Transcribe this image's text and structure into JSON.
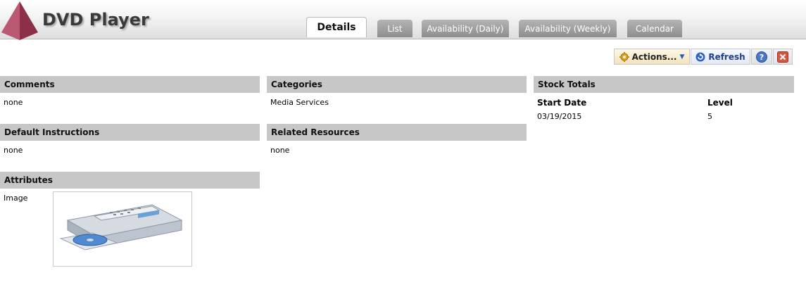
{
  "header": {
    "title": "DVD Player",
    "tabs": [
      {
        "label": "Details",
        "active": true
      },
      {
        "label": "List",
        "active": false
      },
      {
        "label": "Availability (Daily)",
        "active": false
      },
      {
        "label": "Availability (Weekly)",
        "active": false
      },
      {
        "label": "Calendar",
        "active": false
      }
    ]
  },
  "toolbar": {
    "actions_label": "Actions...",
    "refresh_label": "Refresh",
    "help_icon": "help-icon",
    "close_icon": "close-icon"
  },
  "panels": {
    "comments": {
      "title": "Comments",
      "value": "none"
    },
    "default_instructions": {
      "title": "Default Instructions",
      "value": "none"
    },
    "attributes": {
      "title": "Attributes",
      "label": "Image"
    },
    "categories": {
      "title": "Categories",
      "value": "Media Services"
    },
    "related_resources": {
      "title": "Related Resources",
      "value": "none"
    },
    "stock_totals": {
      "title": "Stock Totals",
      "columns": [
        "Start Date",
        "Level"
      ],
      "rows": [
        [
          "03/19/2015",
          "5"
        ]
      ]
    }
  },
  "colors": {
    "panel_header": "#c7c7c7",
    "tab_inactive": "#9e9e9e",
    "logo": "#a8405a",
    "refresh_text": "#1e3f95"
  }
}
